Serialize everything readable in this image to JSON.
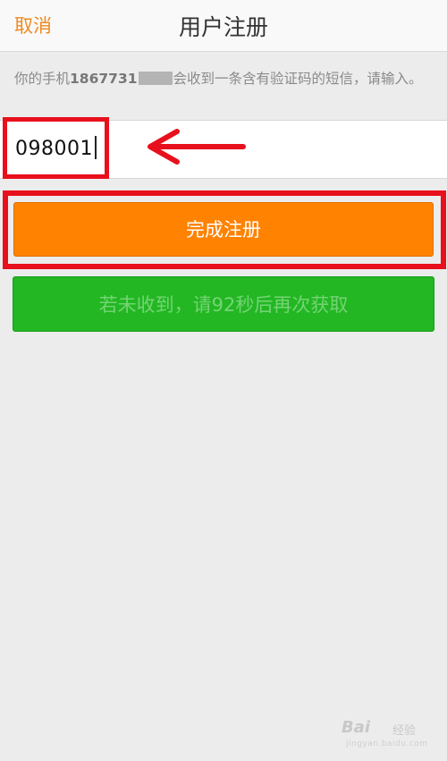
{
  "header": {
    "cancel_label": "取消",
    "title": "用户注册"
  },
  "hint": {
    "prefix": "你的手机",
    "phone": "1867731",
    "suffix": "会收到一条含有验证码的短信，请输入。"
  },
  "code_input": {
    "value": "098001"
  },
  "buttons": {
    "register_label": "完成注册",
    "resend_label": "若未收到，请92秒后再次获取"
  },
  "annotation": {
    "highlight_color": "#e8101c"
  },
  "colors": {
    "accent_orange": "#ff8200",
    "cancel_orange": "#f0891f",
    "resend_green": "#23b723"
  },
  "watermark": {
    "brand": "Bai",
    "brand2": "经验",
    "url": "jingyan.baidu.com"
  }
}
